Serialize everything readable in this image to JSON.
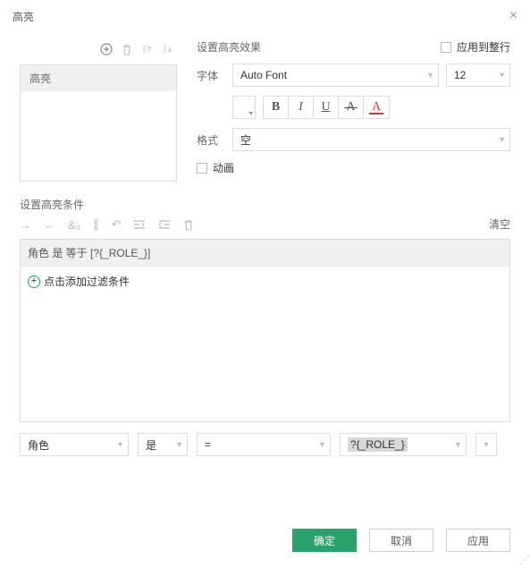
{
  "header": {
    "title": "高亮"
  },
  "left": {
    "item": "高亮"
  },
  "effect": {
    "sectionLabel": "设置高亮效果",
    "applyRowLabel": "应用到整行",
    "fontLabel": "字体",
    "fontValue": "Auto Font",
    "sizeValue": "12",
    "formatLabel": "格式",
    "formatValue": "空",
    "animationLabel": "动画",
    "btns": {
      "b": "B",
      "i": "I",
      "u": "U",
      "a": "A",
      "ac": "A"
    }
  },
  "cond": {
    "sectionLabel": "设置高亮条件",
    "clearLabel": "清空",
    "line": "角色 是 等于 [?{_ROLE_}]",
    "addFilter": "点击添加过滤条件",
    "fields": {
      "col": "角色",
      "op1": "是",
      "op2": "=",
      "val": "?{_ROLE_}"
    }
  },
  "footer": {
    "ok": "确定",
    "cancel": "取消",
    "apply": "应用"
  }
}
